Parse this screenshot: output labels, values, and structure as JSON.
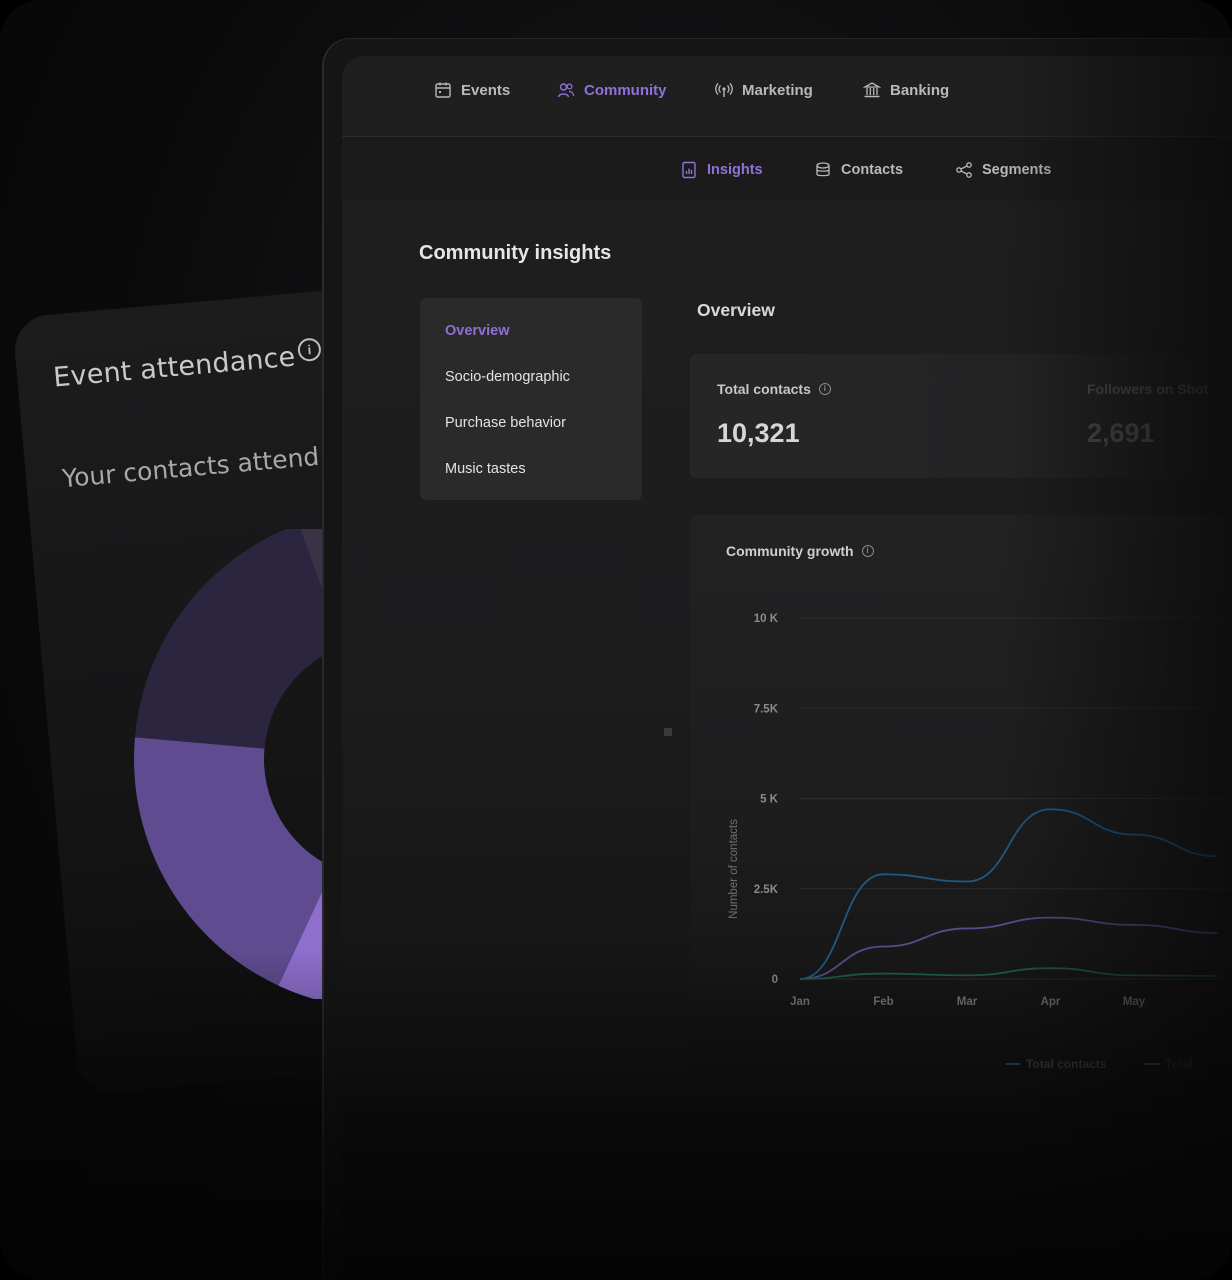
{
  "back_card": {
    "title": "Event attendance",
    "subtitle": "Your contacts attend",
    "donut_colors": [
      "#a98ae6",
      "#8e6fce",
      "#5f4b8f",
      "#2c2540",
      "#3a3346",
      "#cbbaf0"
    ]
  },
  "topnav": {
    "items": [
      {
        "label": "Events",
        "icon": "calendar-icon"
      },
      {
        "label": "Community",
        "icon": "users-icon",
        "active": true
      },
      {
        "label": "Marketing",
        "icon": "broadcast-icon"
      },
      {
        "label": "Banking",
        "icon": "bank-icon"
      }
    ]
  },
  "subnav": {
    "items": [
      {
        "label": "Insights",
        "icon": "report-icon",
        "active": true
      },
      {
        "label": "Contacts",
        "icon": "database-icon"
      },
      {
        "label": "Segments",
        "icon": "share-icon"
      }
    ]
  },
  "page_title": "Community insights",
  "side_menu": {
    "items": [
      "Overview",
      "Socio-demographic",
      "Purchase behavior",
      "Music tastes"
    ],
    "active": "Overview"
  },
  "overview": {
    "title": "Overview",
    "stats": [
      {
        "label": "Total contacts",
        "value": "10,321"
      },
      {
        "label": "Followers on Shot",
        "value": "2,691"
      }
    ]
  },
  "colors": {
    "accent": "#8e72d8",
    "line_total": "#1f5a85",
    "line_purple": "#5c4a8c",
    "line_green": "#1f5b4a"
  },
  "chart_data": {
    "type": "line",
    "title": "Community growth",
    "ylabel": "Number of contacts",
    "ylim": [
      0,
      10000
    ],
    "y_ticks": [
      "0",
      "2.5K",
      "5 K",
      "7.5K",
      "10 K"
    ],
    "x": [
      "Jan",
      "Feb",
      "Mar",
      "Apr",
      "May"
    ],
    "series": [
      {
        "name": "Total contacts",
        "values": [
          0,
          2900,
          2700,
          4700,
          4000
        ]
      },
      {
        "name": "",
        "values": [
          0,
          900,
          1400,
          1700,
          1500
        ]
      },
      {
        "name": "",
        "values": [
          0,
          150,
          100,
          300,
          100
        ]
      }
    ],
    "legend": [
      "Total contacts",
      "Total"
    ]
  }
}
